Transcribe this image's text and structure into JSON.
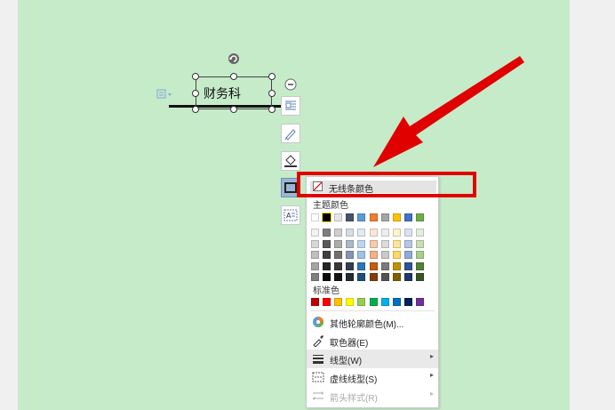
{
  "document": {
    "textbox_text": "财务科"
  },
  "side_tools": [
    {
      "name": "layout-options-tool",
      "icon": "text-wrap-icon"
    },
    {
      "name": "pen-tool",
      "icon": "pen-icon"
    },
    {
      "name": "fill-tool",
      "icon": "paint-bucket-icon"
    },
    {
      "name": "outline-tool",
      "icon": "shape-outline-icon"
    },
    {
      "name": "text-box-tool",
      "icon": "text-box-icon"
    }
  ],
  "menu": {
    "no_line_color": "无线条颜色",
    "theme_colors_label": "主题颜色",
    "standard_colors_label": "标准色",
    "items": [
      {
        "label": "其他轮廓颜色(M)...",
        "icon": "color-wheel-icon",
        "submenu": false,
        "disabled": false
      },
      {
        "label": "取色器(E)",
        "icon": "eyedropper-icon",
        "submenu": false,
        "disabled": false
      },
      {
        "label": "线型(W)",
        "icon": "line-weight-icon",
        "submenu": true,
        "disabled": false
      },
      {
        "label": "虚线线型(S)",
        "icon": "dash-type-icon",
        "submenu": true,
        "disabled": false
      },
      {
        "label": "箭头样式(R)",
        "icon": "arrow-style-icon",
        "submenu": true,
        "disabled": true
      }
    ]
  },
  "palette": {
    "theme_row": [
      "#ffffff",
      "#000000",
      "#e7e6e6",
      "#44546a",
      "#5b9bd5",
      "#ed7d31",
      "#a5a5a5",
      "#ffc000",
      "#4472c4",
      "#70ad47"
    ],
    "theme_shades": [
      [
        "#f2f2f2",
        "#7f7f7f",
        "#d0cece",
        "#d6dce4",
        "#deebf6",
        "#fbe5d5",
        "#ededed",
        "#fff2cc",
        "#d9e2f3",
        "#e2efd9"
      ],
      [
        "#d8d8d8",
        "#595959",
        "#aeabab",
        "#adb9ca",
        "#bdd7ee",
        "#f7cbac",
        "#dbdbdb",
        "#fee599",
        "#b4c6e7",
        "#c5e0b3"
      ],
      [
        "#bfbfbf",
        "#3f3f3f",
        "#757070",
        "#8496b0",
        "#9cc3e5",
        "#f4b183",
        "#c9c9c9",
        "#ffd965",
        "#8eaadb",
        "#a8d08d"
      ],
      [
        "#a5a5a5",
        "#262626",
        "#3a3838",
        "#323f4f",
        "#2e75b5",
        "#c55a11",
        "#7b7b7b",
        "#bf9000",
        "#2f5496",
        "#538135"
      ],
      [
        "#7f7f7f",
        "#0c0c0c",
        "#171616",
        "#222a35",
        "#1e4e79",
        "#833c0b",
        "#525252",
        "#7f6000",
        "#1f3864",
        "#375623"
      ]
    ],
    "standard": [
      "#c00000",
      "#ff0000",
      "#ffc000",
      "#ffff00",
      "#92d050",
      "#00b050",
      "#00b0f0",
      "#0070c0",
      "#002060",
      "#7030a0"
    ],
    "selected_theme_index": 1
  },
  "colors": {
    "page_background": "#c6ebc9",
    "gutter": "#f0f0f0",
    "highlight": "#e00000",
    "annotation_arrow": "#e00000"
  }
}
